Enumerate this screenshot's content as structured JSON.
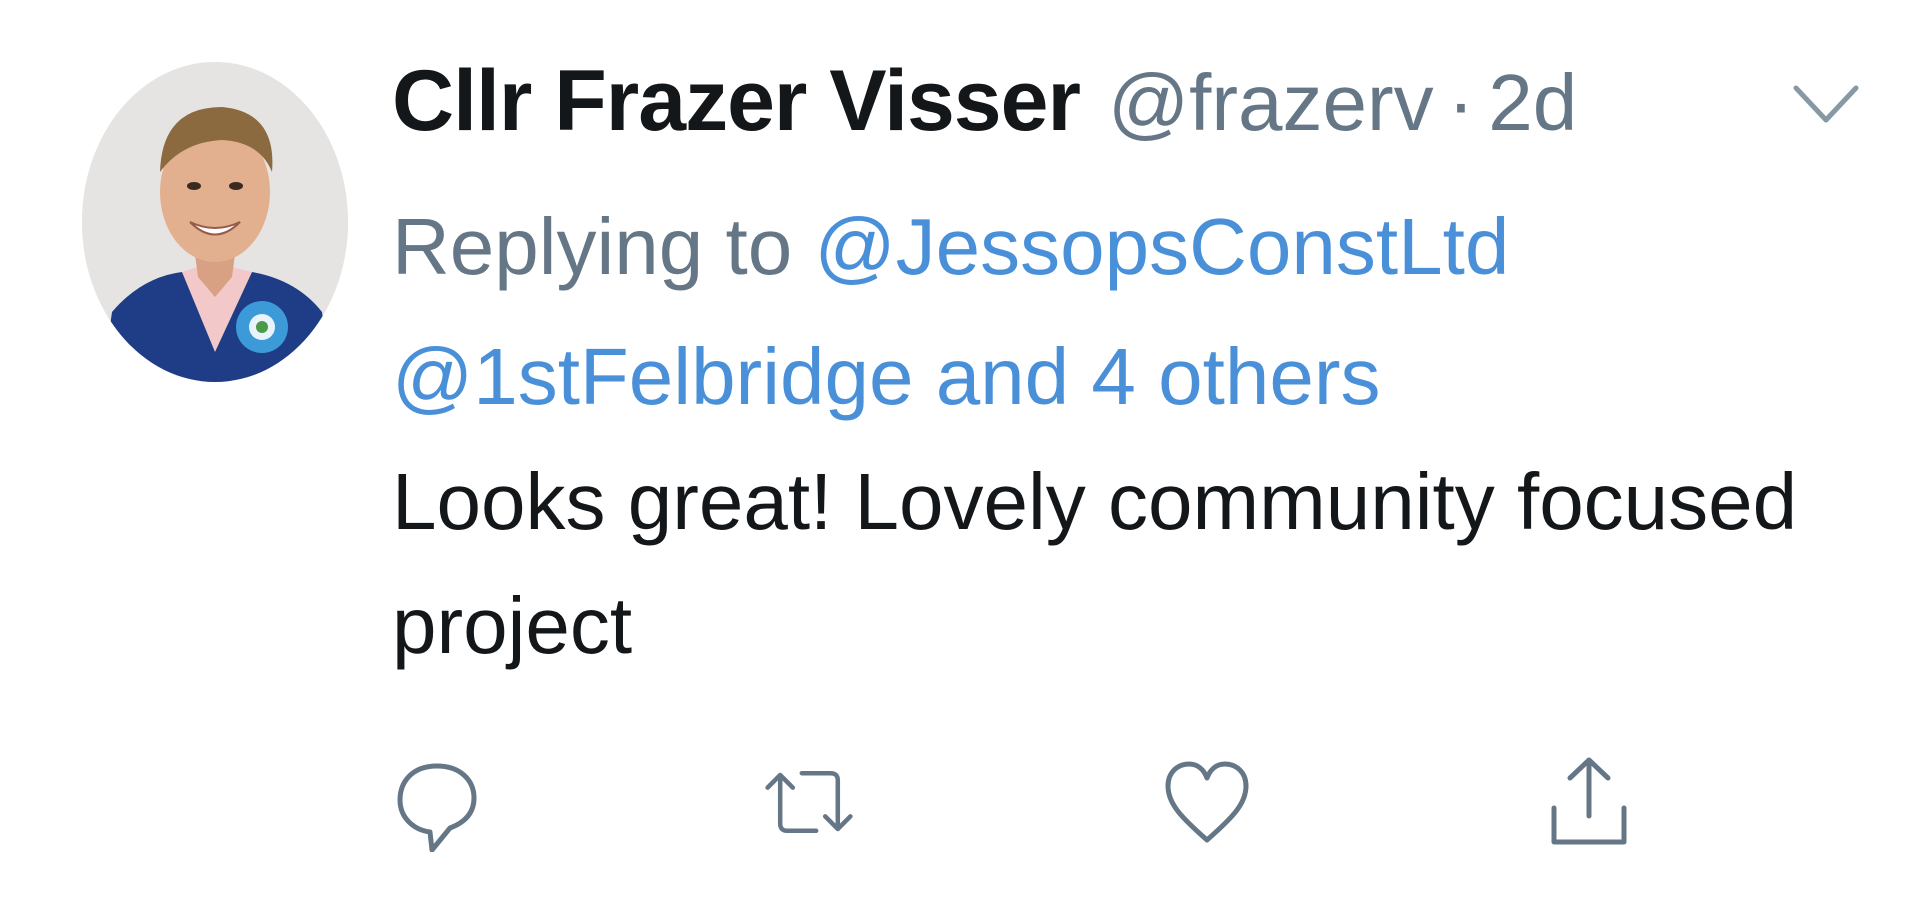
{
  "tweet": {
    "author": {
      "display_name": "Cllr Frazer Visser",
      "handle": "@frazerv",
      "separator": "·",
      "timestamp": "2d"
    },
    "reply_context": {
      "prefix": "Replying to",
      "mention_1": "@JessopsConstLtd",
      "mention_2": "@1stFelbridge",
      "others": "and 4 others"
    },
    "text": "Looks great! Lovely community focused project",
    "actions": [
      "reply-icon",
      "retweet-icon",
      "like-icon",
      "share-icon"
    ],
    "more_icon": "chevron-down-icon"
  },
  "colors": {
    "name": "#14171a",
    "muted": "#657786",
    "link": "#4a90d9",
    "icon": "#657786"
  }
}
